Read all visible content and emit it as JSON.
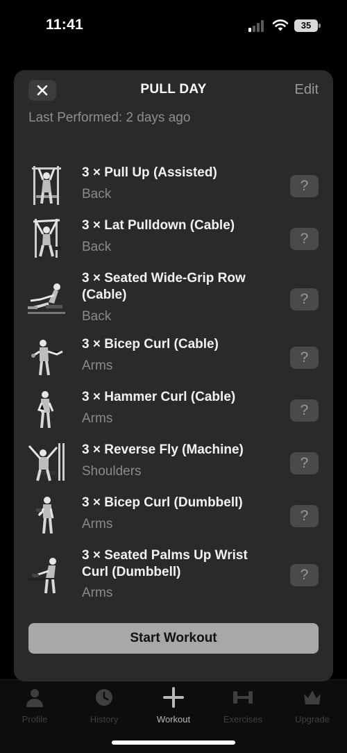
{
  "status": {
    "time": "11:41",
    "battery": "35"
  },
  "sheet": {
    "title": "PULL DAY",
    "edit_label": "Edit",
    "last_performed": "Last Performed: 2 days ago",
    "start_label": "Start Workout"
  },
  "exercises": [
    {
      "name": "3 × Pull Up (Assisted)",
      "muscle": "Back",
      "help": "?"
    },
    {
      "name": "3 × Lat Pulldown (Cable)",
      "muscle": "Back",
      "help": "?"
    },
    {
      "name": "3 × Seated Wide-Grip Row (Cable)",
      "muscle": "Back",
      "help": "?"
    },
    {
      "name": "3 × Bicep Curl (Cable)",
      "muscle": "Arms",
      "help": "?"
    },
    {
      "name": "3 × Hammer Curl (Cable)",
      "muscle": "Arms",
      "help": "?"
    },
    {
      "name": "3 × Reverse Fly (Machine)",
      "muscle": "Shoulders",
      "help": "?"
    },
    {
      "name": "3 × Bicep Curl (Dumbbell)",
      "muscle": "Arms",
      "help": "?"
    },
    {
      "name": "3 × Seated Palms Up Wrist Curl (Dumbbell)",
      "muscle": "Arms",
      "help": "?"
    }
  ],
  "tabs": [
    {
      "label": "Profile",
      "icon": "person-icon"
    },
    {
      "label": "History",
      "icon": "clock-icon"
    },
    {
      "label": "Workout",
      "icon": "plus-icon",
      "active": true
    },
    {
      "label": "Exercises",
      "icon": "dumbbell-icon"
    },
    {
      "label": "Upgrade",
      "icon": "crown-icon"
    }
  ]
}
